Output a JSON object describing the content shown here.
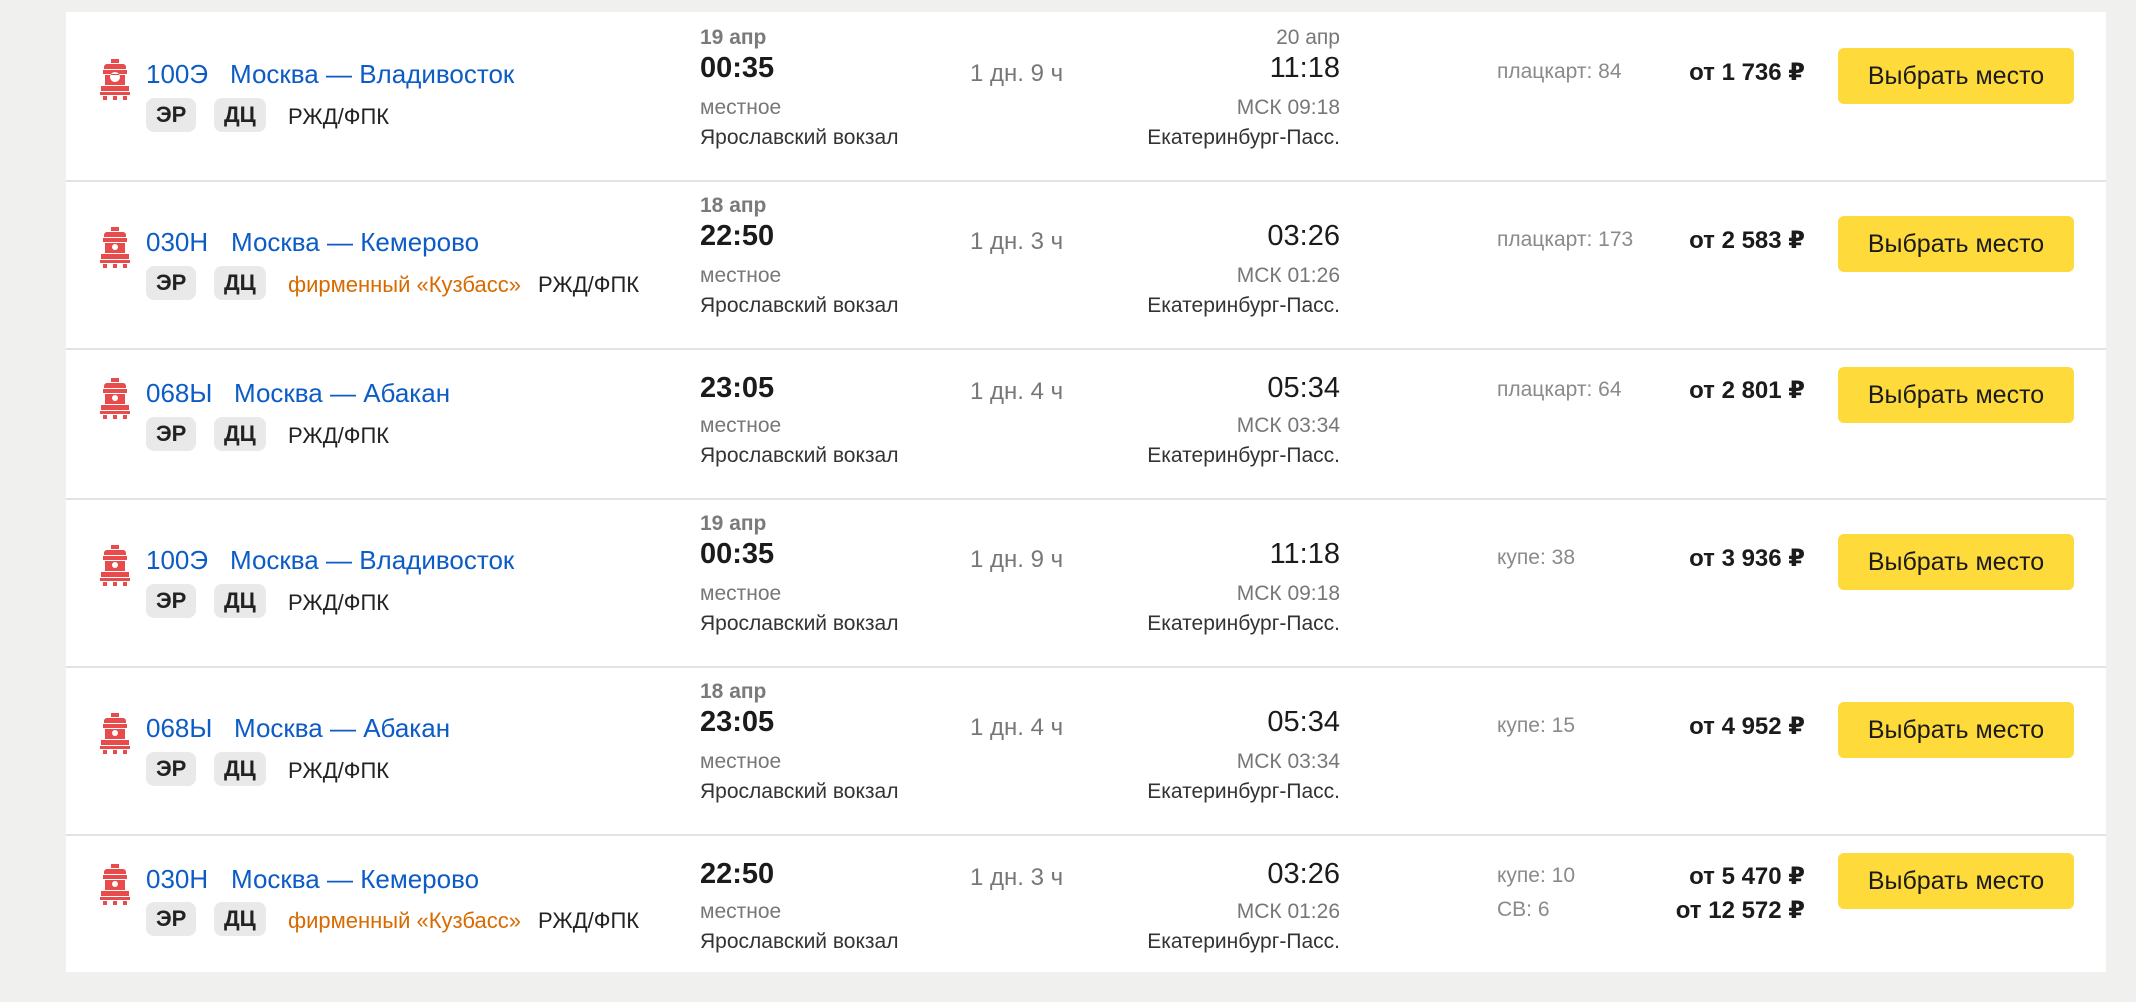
{
  "colors": {
    "link": "#0d5cc6",
    "button": "#fedb3a",
    "branded": "#d86a00",
    "icon": "#e84b4b"
  },
  "icons": {
    "train": "steam-locomotive-icon"
  },
  "rows": [
    {
      "number": "100Э",
      "route": "Москва — Владивосток",
      "badge1": "ЭР",
      "badge2": "ДЦ",
      "branded": "",
      "carrier": "РЖД/ФПК",
      "dep_date": "19 апр",
      "dep_time": "00:35",
      "dep_tz": "местное",
      "dep_station": "Ярославский вокзал",
      "duration": "1 дн. 9 ч",
      "arr_date": "20 апр",
      "arr_time": "11:18",
      "arr_msk": "МСК 09:18",
      "arr_station": "Екатеринбург-Пасс.",
      "seats": [
        "плацкарт: 84"
      ],
      "prices": [
        "от 1 736 ₽"
      ],
      "button": "Выбрать место"
    },
    {
      "number": "030Н",
      "route": "Москва — Кемерово",
      "badge1": "ЭР",
      "badge2": "ДЦ",
      "branded": "фирменный «Кузбасс»",
      "carrier": "РЖД/ФПК",
      "dep_date": "18 апр",
      "dep_time": "22:50",
      "dep_tz": "местное",
      "dep_station": "Ярославский вокзал",
      "duration": "1 дн. 3 ч",
      "arr_date": "",
      "arr_time": "03:26",
      "arr_msk": "МСК 01:26",
      "arr_station": "Екатеринбург-Пасс.",
      "seats": [
        "плацкарт: 173"
      ],
      "prices": [
        "от 2 583 ₽"
      ],
      "button": "Выбрать место"
    },
    {
      "number": "068Ы",
      "route": "Москва — Абакан",
      "badge1": "ЭР",
      "badge2": "ДЦ",
      "branded": "",
      "carrier": "РЖД/ФПК",
      "dep_date": "",
      "dep_time": "23:05",
      "dep_tz": "местное",
      "dep_station": "Ярославский вокзал",
      "duration": "1 дн. 4 ч",
      "arr_date": "",
      "arr_time": "05:34",
      "arr_msk": "МСК 03:34",
      "arr_station": "Екатеринбург-Пасс.",
      "seats": [
        "плацкарт: 64"
      ],
      "prices": [
        "от 2 801 ₽"
      ],
      "button": "Выбрать место"
    },
    {
      "number": "100Э",
      "route": "Москва — Владивосток",
      "badge1": "ЭР",
      "badge2": "ДЦ",
      "branded": "",
      "carrier": "РЖД/ФПК",
      "dep_date": "19 апр",
      "dep_time": "00:35",
      "dep_tz": "местное",
      "dep_station": "Ярославский вокзал",
      "duration": "1 дн. 9 ч",
      "arr_date": "",
      "arr_time": "11:18",
      "arr_msk": "МСК 09:18",
      "arr_station": "Екатеринбург-Пасс.",
      "seats": [
        "купе: 38"
      ],
      "prices": [
        "от 3 936 ₽"
      ],
      "button": "Выбрать место"
    },
    {
      "number": "068Ы",
      "route": "Москва — Абакан",
      "badge1": "ЭР",
      "badge2": "ДЦ",
      "branded": "",
      "carrier": "РЖД/ФПК",
      "dep_date": "18 апр",
      "dep_time": "23:05",
      "dep_tz": "местное",
      "dep_station": "Ярославский вокзал",
      "duration": "1 дн. 4 ч",
      "arr_date": "",
      "arr_time": "05:34",
      "arr_msk": "МСК 03:34",
      "arr_station": "Екатеринбург-Пасс.",
      "seats": [
        "купе: 15"
      ],
      "prices": [
        "от 4 952 ₽"
      ],
      "button": "Выбрать место"
    },
    {
      "number": "030Н",
      "route": "Москва — Кемерово",
      "badge1": "ЭР",
      "badge2": "ДЦ",
      "branded": "фирменный «Кузбасс»",
      "carrier": "РЖД/ФПК",
      "dep_date": "",
      "dep_time": "22:50",
      "dep_tz": "местное",
      "dep_station": "Ярославский вокзал",
      "duration": "1 дн. 3 ч",
      "arr_date": "",
      "arr_time": "03:26",
      "arr_msk": "МСК 01:26",
      "arr_station": "Екатеринбург-Пасс.",
      "seats": [
        "купе: 10",
        "СВ: 6"
      ],
      "prices": [
        "от 5 470 ₽",
        "от 12 572 ₽"
      ],
      "button": "Выбрать место"
    }
  ]
}
